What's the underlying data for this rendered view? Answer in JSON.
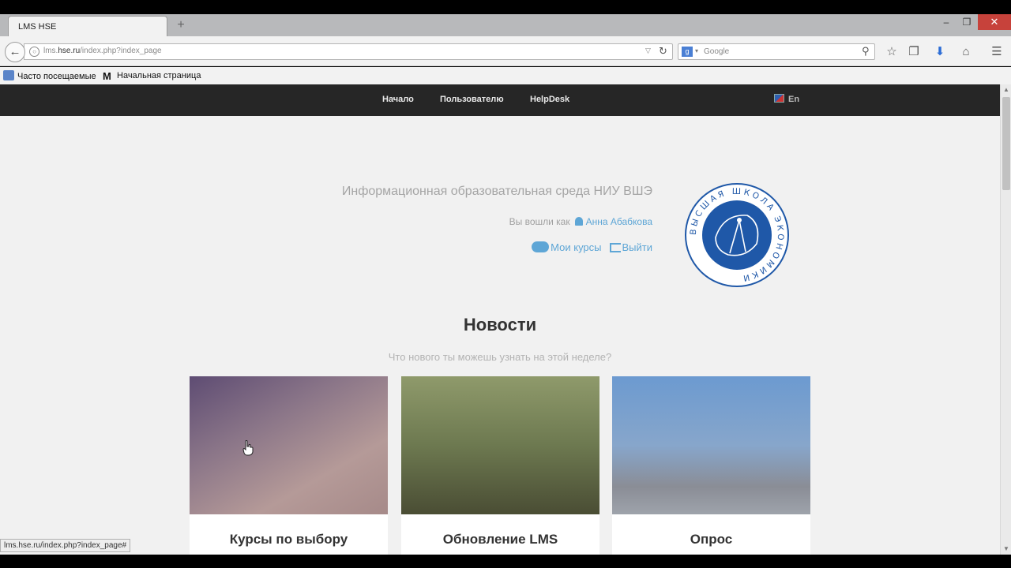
{
  "browser": {
    "tab_title": "LMS HSE",
    "new_tab_glyph": "+",
    "url_prefix": "lms.",
    "url_host": "hse.ru",
    "url_path": "/index.php?index_page",
    "search_placeholder": "Google",
    "bookmarks": [
      "Часто посещаемые",
      "Начальная страница"
    ],
    "status_url": "lms.hse.ru/index.php?index_page#"
  },
  "site": {
    "nav": [
      "Начало",
      "Пользователю",
      "HelpDesk"
    ],
    "lang": "En",
    "portal_title": "Информационная образовательная среда НИУ ВШЭ",
    "logged_in_prefix": "Вы вошли как",
    "user_name": "Анна Абабкова",
    "my_courses": "Мои курсы",
    "logout": "Выйти",
    "logo_text": "ВЫСШАЯ ШКОЛА ЭКОНОМИКИ",
    "news_title": "Новости",
    "news_subtitle": "Что нового ты можешь узнать на этой неделе?",
    "cards": [
      {
        "title": "Курсы по выбору"
      },
      {
        "title": "Обновление LMS"
      },
      {
        "title": "Опрос"
      }
    ]
  },
  "icons": {
    "back": "back-arrow-icon",
    "reload": "reload-icon",
    "bookmark_star": "star-icon",
    "clipboard": "clipboard-icon",
    "download": "download-icon",
    "home": "home-icon",
    "menu": "hamburger-menu-icon"
  },
  "colors": {
    "site_nav_bg": "#262626",
    "link": "#5ea6d6",
    "logo_blue": "#1f58a8",
    "page_bg": "#f1f1f1"
  }
}
